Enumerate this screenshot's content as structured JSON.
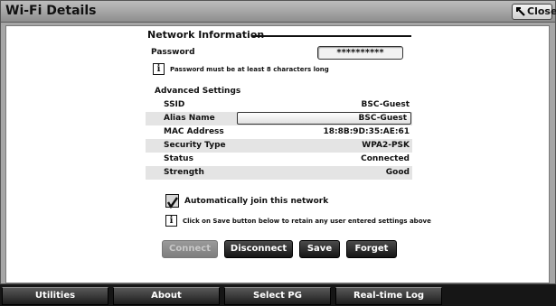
{
  "window": {
    "title": "Wi-Fi Details",
    "close_label": "Close"
  },
  "network_info": {
    "section_title": "Network Information",
    "password_label": "Password",
    "password_value": "**********",
    "password_hint": "Password must be at least 8 characters long",
    "advanced_title": "Advanced Settings",
    "rows": [
      {
        "key": "SSID",
        "value": "BSC-Guest"
      },
      {
        "key": "Alias Name",
        "value": "BSC-Guest"
      },
      {
        "key": "MAC Address",
        "value": "18:8B:9D:35:AE:61"
      },
      {
        "key": "Security Type",
        "value": "WPA2-PSK"
      },
      {
        "key": "Status",
        "value": "Connected"
      },
      {
        "key": "Strength",
        "value": "Good"
      }
    ],
    "auto_join_label": "Automatically join this network",
    "auto_join_checked": true,
    "save_hint": "Click on Save button below to retain any user entered settings above"
  },
  "actions": {
    "connect": "Connect",
    "disconnect": "Disconnect",
    "save": "Save",
    "forget": "Forget"
  },
  "bottom_nav": {
    "utilities": "Utilities",
    "about": "About",
    "select_pg": "Select PG",
    "realtime_log": "Real-time Log"
  },
  "icons": {
    "close": "close-arrow-icon",
    "info": "info-icon",
    "check": "check-icon"
  },
  "colors": {
    "button_dark": "#1d1d1d",
    "panel_bg": "#ffffff",
    "chrome_gray": "#a6a6a6",
    "row_shade": "#e4e4e4"
  }
}
